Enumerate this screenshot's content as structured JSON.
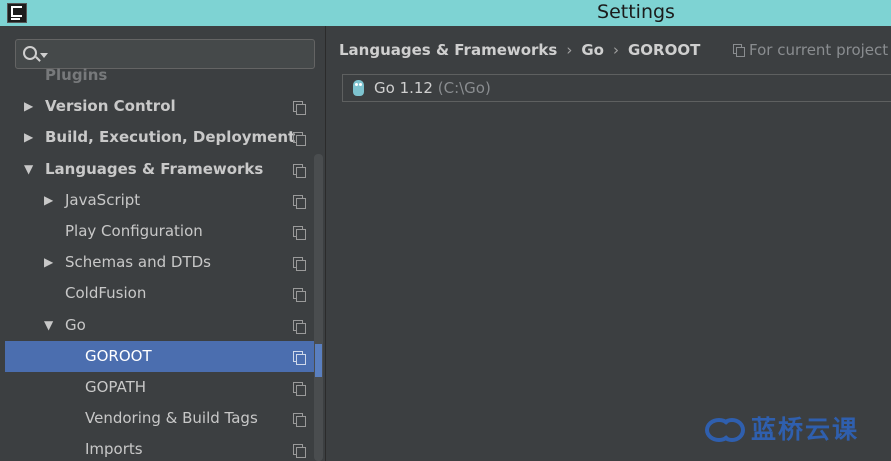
{
  "window": {
    "title": "Settings"
  },
  "sidebar": {
    "search": {
      "placeholder": "",
      "value": ""
    },
    "items": [
      {
        "label": "Plugins",
        "level": 0,
        "expanded": false,
        "has_arrow": false,
        "bold": true,
        "faded": true,
        "selected": false
      },
      {
        "label": "Version Control",
        "level": 0,
        "expanded": false,
        "has_arrow": true,
        "bold": true,
        "faded": false,
        "selected": false
      },
      {
        "label": "Build, Execution, Deployment",
        "level": 0,
        "expanded": false,
        "has_arrow": true,
        "bold": true,
        "faded": false,
        "selected": false
      },
      {
        "label": "Languages & Frameworks",
        "level": 0,
        "expanded": true,
        "has_arrow": true,
        "bold": true,
        "faded": false,
        "selected": false
      },
      {
        "label": "JavaScript",
        "level": 1,
        "expanded": false,
        "has_arrow": true,
        "bold": false,
        "faded": false,
        "selected": false
      },
      {
        "label": "Play Configuration",
        "level": 1,
        "expanded": false,
        "has_arrow": false,
        "bold": false,
        "faded": false,
        "selected": false
      },
      {
        "label": "Schemas and DTDs",
        "level": 1,
        "expanded": false,
        "has_arrow": true,
        "bold": false,
        "faded": false,
        "selected": false
      },
      {
        "label": "ColdFusion",
        "level": 1,
        "expanded": false,
        "has_arrow": false,
        "bold": false,
        "faded": false,
        "selected": false
      },
      {
        "label": "Go",
        "level": 1,
        "expanded": true,
        "has_arrow": true,
        "bold": false,
        "faded": false,
        "selected": false
      },
      {
        "label": "GOROOT",
        "level": 2,
        "expanded": false,
        "has_arrow": false,
        "bold": false,
        "faded": false,
        "selected": true
      },
      {
        "label": "GOPATH",
        "level": 2,
        "expanded": false,
        "has_arrow": false,
        "bold": false,
        "faded": false,
        "selected": false
      },
      {
        "label": "Vendoring & Build Tags",
        "level": 2,
        "expanded": false,
        "has_arrow": false,
        "bold": false,
        "faded": false,
        "selected": false
      },
      {
        "label": "Imports",
        "level": 2,
        "expanded": false,
        "has_arrow": false,
        "bold": false,
        "faded": false,
        "selected": false
      }
    ]
  },
  "main": {
    "breadcrumb": [
      "Languages & Frameworks",
      "Go",
      "GOROOT"
    ],
    "scope_label": "For current project",
    "sdk": {
      "name": "Go 1.12",
      "path": "(C:\\Go)"
    }
  },
  "watermark": {
    "text": "蓝桥云课"
  },
  "colors": {
    "titlebar": "#7ed3d3",
    "panel": "#3c3f41",
    "selection": "#4b6eaf",
    "watermark": "#2f5fae"
  },
  "icons": {
    "app": "intellij-icon",
    "search": "search-icon",
    "copy": "project-scope-icon",
    "sdk": "go-gopher-icon"
  }
}
